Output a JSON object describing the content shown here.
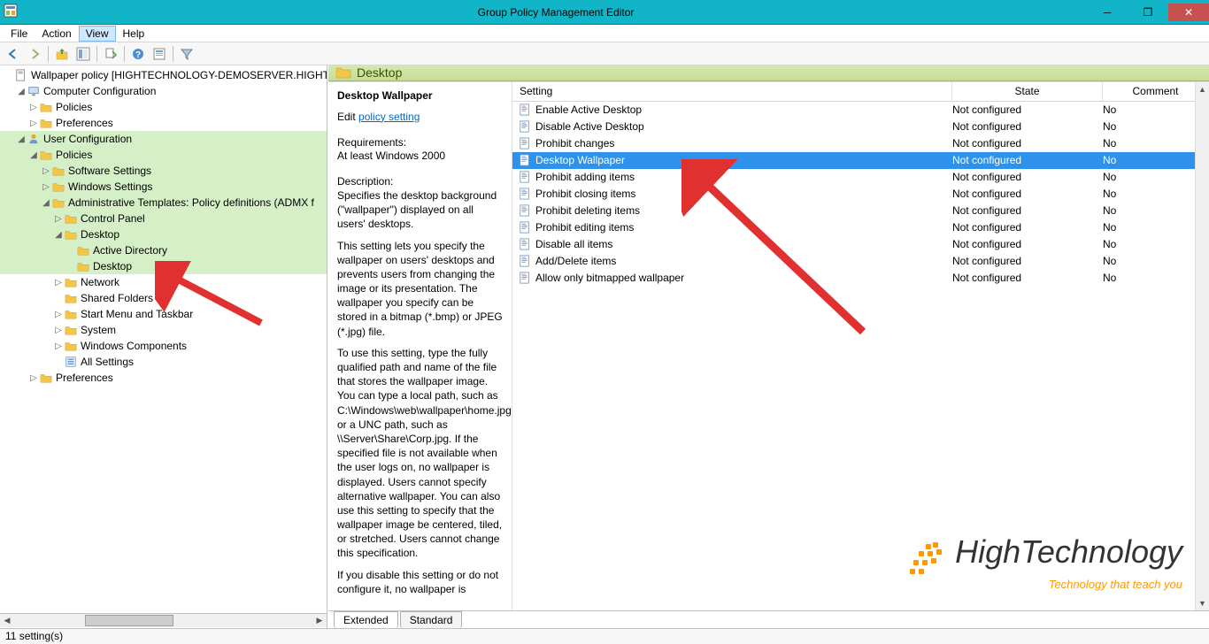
{
  "window": {
    "title": "Group Policy Management Editor"
  },
  "menus": {
    "file": "File",
    "action": "Action",
    "view": "View",
    "help": "Help"
  },
  "tree": {
    "root": "Wallpaper policy [HIGHTECHNOLOGY-DEMOSERVER.HIGHTECH",
    "comp_config": "Computer Configuration",
    "cc_policies": "Policies",
    "cc_prefs": "Preferences",
    "user_config": "User Configuration",
    "uc_policies": "Policies",
    "sw_settings": "Software Settings",
    "win_settings": "Windows Settings",
    "admin_templates": "Administrative Templates: Policy definitions (ADMX f",
    "control_panel": "Control Panel",
    "desktop": "Desktop",
    "active_directory": "Active Directory",
    "desktop_sub": "Desktop",
    "network": "Network",
    "shared_folders": "Shared Folders",
    "start_menu": "Start Menu and Taskbar",
    "system": "System",
    "win_components": "Windows Components",
    "all_settings": "All Settings",
    "uc_prefs": "Preferences"
  },
  "right": {
    "header": "Desktop",
    "desc": {
      "title": "Desktop Wallpaper",
      "edit_prefix": "Edit ",
      "edit_link": "policy setting",
      "req_label": "Requirements:",
      "req_text": "At least Windows 2000",
      "desc_label": "Description:",
      "desc_p1": "Specifies the desktop background (\"wallpaper\") displayed on all users' desktops.",
      "desc_p2": "This setting lets you specify the wallpaper on users' desktops and prevents users from changing the image or its presentation. The wallpaper you specify can be stored in a bitmap (*.bmp) or JPEG (*.jpg) file.",
      "desc_p3": "To use this setting, type the fully qualified path and name of the file that stores the wallpaper image. You can type a local path, such as C:\\Windows\\web\\wallpaper\\home.jpg or a UNC path, such as \\\\Server\\Share\\Corp.jpg. If the specified file is not available when the user logs on, no wallpaper is displayed. Users cannot specify alternative wallpaper. You can also use this setting to specify that the wallpaper image be centered, tiled, or stretched. Users cannot change this specification.",
      "desc_p4": "If you disable this setting or do not configure it, no wallpaper is"
    },
    "columns": {
      "setting": "Setting",
      "state": "State",
      "comment": "Comment"
    },
    "settings": [
      {
        "name": "Enable Active Desktop",
        "state": "Not configured",
        "comment": "No",
        "selected": false
      },
      {
        "name": "Disable Active Desktop",
        "state": "Not configured",
        "comment": "No",
        "selected": false
      },
      {
        "name": "Prohibit changes",
        "state": "Not configured",
        "comment": "No",
        "selected": false
      },
      {
        "name": "Desktop Wallpaper",
        "state": "Not configured",
        "comment": "No",
        "selected": true
      },
      {
        "name": "Prohibit adding items",
        "state": "Not configured",
        "comment": "No",
        "selected": false
      },
      {
        "name": "Prohibit closing items",
        "state": "Not configured",
        "comment": "No",
        "selected": false
      },
      {
        "name": "Prohibit deleting items",
        "state": "Not configured",
        "comment": "No",
        "selected": false
      },
      {
        "name": "Prohibit editing items",
        "state": "Not configured",
        "comment": "No",
        "selected": false
      },
      {
        "name": "Disable all items",
        "state": "Not configured",
        "comment": "No",
        "selected": false
      },
      {
        "name": "Add/Delete items",
        "state": "Not configured",
        "comment": "No",
        "selected": false
      },
      {
        "name": "Allow only bitmapped wallpaper",
        "state": "Not configured",
        "comment": "No",
        "selected": false
      }
    ],
    "tabs": {
      "extended": "Extended",
      "standard": "Standard"
    }
  },
  "statusbar": "11 setting(s)",
  "watermark": {
    "brand": "HighTechnology",
    "tagline": "Technology that teach you"
  }
}
